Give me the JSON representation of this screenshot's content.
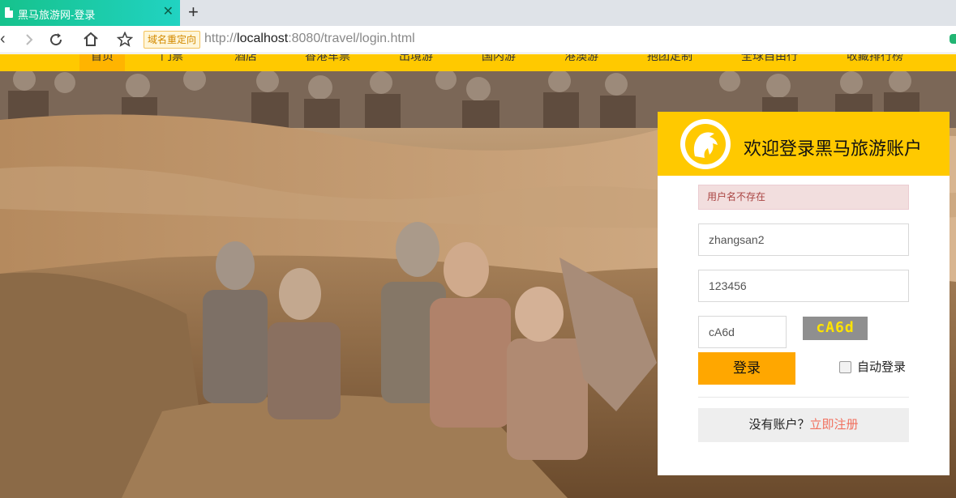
{
  "browser": {
    "tab_title": "黑马旅游网-登录",
    "tab_close": "✕",
    "new_tab": "+",
    "redirect_badge": "域名重定向",
    "url_scheme": "http://",
    "url_host": "localhost",
    "url_rest": ":8080/travel/login.html"
  },
  "nav": {
    "items": [
      "首页",
      "门票",
      "酒店",
      "香港车票",
      "出境游",
      "国内游",
      "港澳游",
      "抱团定制",
      "全球自由行",
      "收藏排行榜"
    ],
    "active_index": 0
  },
  "login": {
    "title": "欢迎登录黑马旅游账户",
    "error_message": "用户名不存在",
    "username_value": "zhangsan2",
    "password_value": "123456",
    "code_value": "cA6d",
    "captcha_text": "cA6d",
    "login_button": "登录",
    "auto_login_label": "自动登录",
    "auto_login_checked": false,
    "no_account_text": "没有账户？",
    "register_link": "立即注册"
  },
  "colors": {
    "brand_yellow": "#ffc900",
    "button_orange": "#ffa700",
    "link_red": "#f1705e",
    "error_bg": "#f2dede",
    "tab_green": "#16c28c"
  },
  "icons": [
    "page-icon",
    "back-icon",
    "forward-icon",
    "reload-icon",
    "home-icon",
    "star-icon",
    "logo-icon",
    "extension-icon"
  ]
}
